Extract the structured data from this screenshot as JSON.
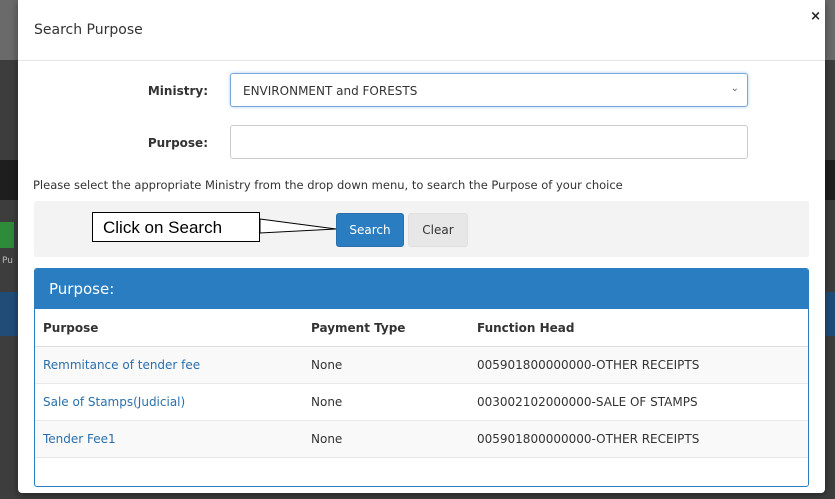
{
  "modal": {
    "title": "Search Purpose",
    "close_label": "×"
  },
  "form": {
    "ministry_label": "Ministry:",
    "ministry_value": "ENVIRONMENT and FORESTS",
    "purpose_label": "Purpose:",
    "purpose_value": "",
    "instructions": "Please select the appropriate Ministry from the drop down menu, to search the Purpose of your choice"
  },
  "buttons": {
    "search": "Search",
    "clear": "Clear"
  },
  "callout": {
    "text": "Click on Search"
  },
  "results": {
    "panel_title": "Purpose:",
    "columns": [
      "Purpose",
      "Payment Type",
      "Function Head"
    ],
    "rows": [
      {
        "purpose": "Remmitance of tender fee",
        "payment_type": "None",
        "function_head": "005901800000000-OTHER RECEIPTS"
      },
      {
        "purpose": "Sale of Stamps(Judicial)",
        "payment_type": "None",
        "function_head": "003002102000000-SALE OF STAMPS"
      },
      {
        "purpose": "Tender Fee1",
        "payment_type": "None",
        "function_head": "005901800000000-OTHER RECEIPTS"
      }
    ]
  },
  "background": {
    "partial_text": "Pu"
  },
  "colors": {
    "primary": "#2a7dc0",
    "link": "#2a6fab"
  }
}
